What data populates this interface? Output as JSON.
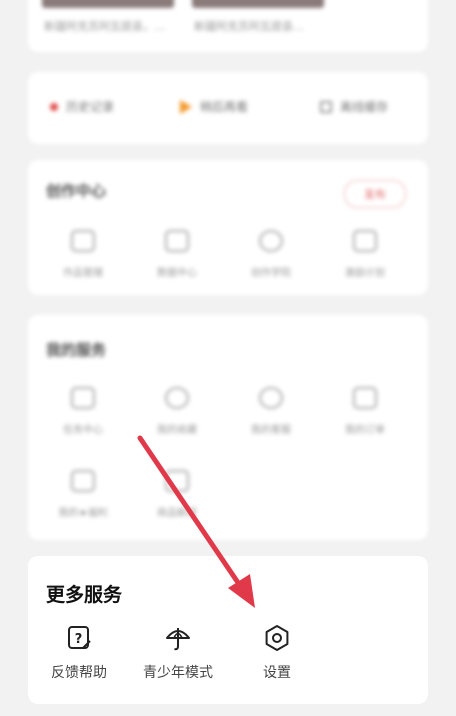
{
  "thumbs": {
    "captions": [
      "新疆阿克苏阿瓦提县，…",
      "新疆阿克苏阿瓦提县…"
    ]
  },
  "shortcuts": [
    {
      "label": "历史记录",
      "icon": "record-dot-icon"
    },
    {
      "label": "稍后再看",
      "icon": "play-later-icon"
    },
    {
      "label": "离线缓存",
      "icon": "offline-icon"
    }
  ],
  "creator": {
    "title": "创作中心",
    "pill": "发布",
    "items": [
      "作品管理",
      "数据中心",
      "创作学院",
      "激励计划"
    ]
  },
  "tasks": {
    "title": "我的服务",
    "row1": [
      "任务中心",
      "我的收藏",
      "我的客服",
      "我的订单"
    ],
    "row2": [
      "我的★福利",
      "商品橱窗"
    ]
  },
  "more": {
    "title": "更多服务",
    "items": [
      {
        "label": "反馈帮助",
        "icon": "feedback-help-icon"
      },
      {
        "label": "青少年模式",
        "icon": "umbrella-icon"
      },
      {
        "label": "设置",
        "icon": "settings-hexagon-icon"
      }
    ]
  },
  "colors": {
    "arrow": "#e03a4a",
    "background": "#f2f2f2",
    "card": "#ffffff"
  }
}
